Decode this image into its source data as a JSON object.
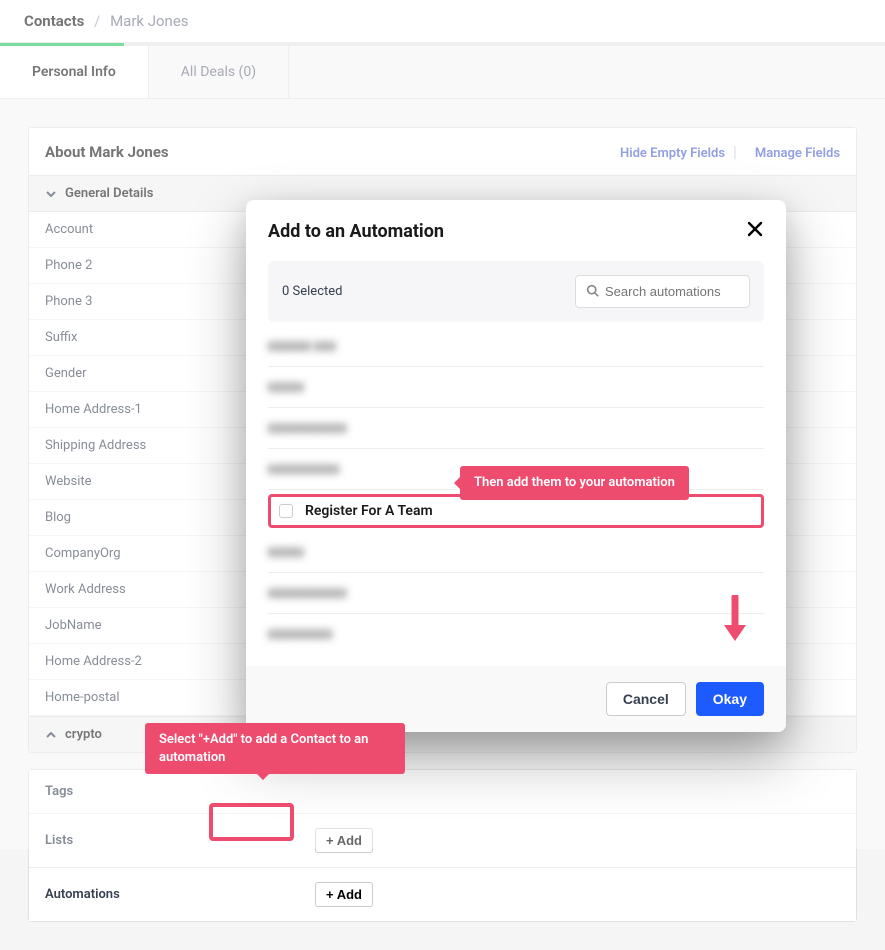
{
  "breadcrumb": {
    "root": "Contacts",
    "sep": "/",
    "current": "Mark Jones"
  },
  "tabs": {
    "personal": "Personal Info",
    "deals": "All Deals (0)"
  },
  "about": {
    "title": "About Mark Jones",
    "hide_link": "Hide Empty Fields",
    "manage_link": "Manage Fields"
  },
  "general_section": "General Details",
  "fields": [
    "Account",
    "Phone 2",
    "Phone 3",
    "Suffix",
    "Gender",
    "Home Address-1",
    "Shipping Address",
    "Website",
    "Blog",
    "CompanyOrg",
    "Work Address",
    "JobName",
    "Home Address-2",
    "Home-postal"
  ],
  "crypto_section": "crypto",
  "lower_rows": {
    "tags": "Tags",
    "lists": "Lists",
    "automations": "Automations",
    "add_btn": "+ Add"
  },
  "modal": {
    "title": "Add to an Automation",
    "selected": "0 Selected",
    "search_placeholder": "Search automations",
    "highlighted_item": "Register For A Team",
    "cancel": "Cancel",
    "okay": "Okay"
  },
  "callouts": {
    "c1": "Then add them to your automation",
    "c2": "Select \"+Add\" to add a Contact to an automation"
  }
}
